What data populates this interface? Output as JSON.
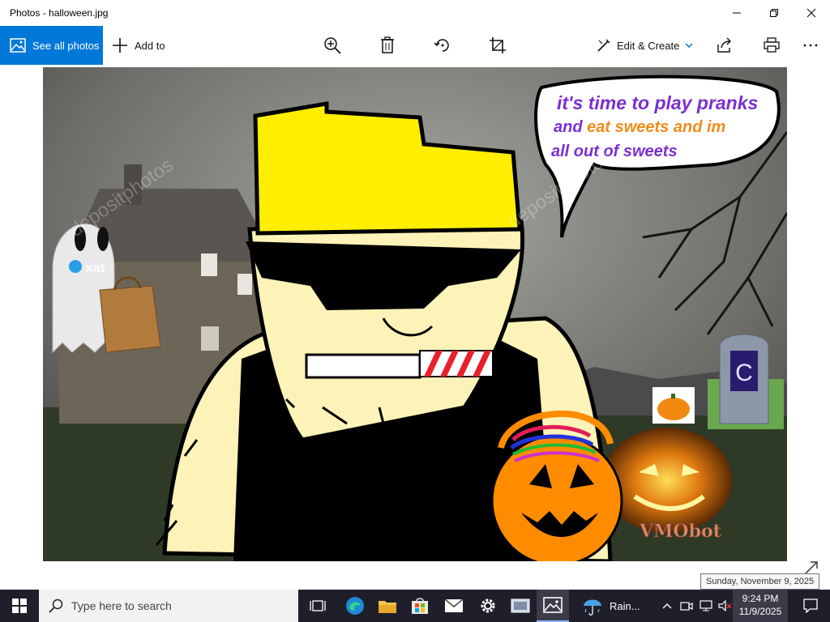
{
  "window": {
    "title": "Photos - halloween.jpg"
  },
  "toolbar": {
    "see_all_label": "See all photos",
    "add_to_label": "Add to",
    "edit_create_label": "Edit & Create"
  },
  "photo": {
    "speech_line1": "it's time to play pranks",
    "speech_line2_a": "and ",
    "speech_line2_b": "eat sweets and im",
    "speech_line3": "all out of sweets",
    "xat_label": "xat",
    "tombstone_letter": "C",
    "signature": "VMObot",
    "watermark": "depositphotos"
  },
  "tooltip": {
    "text": "Sunday, November 9, 2025"
  },
  "taskbar": {
    "search_placeholder": "Type here to search",
    "weather_label": "Rain...",
    "time": "9:24 PM",
    "date": "11/9/2025"
  },
  "colors": {
    "accent": "#0078d7",
    "speech_purple": "#7b2fd0",
    "speech_orange": "#f08c1a",
    "hair_yellow": "#ffee00",
    "skin": "#fdf3b8"
  }
}
